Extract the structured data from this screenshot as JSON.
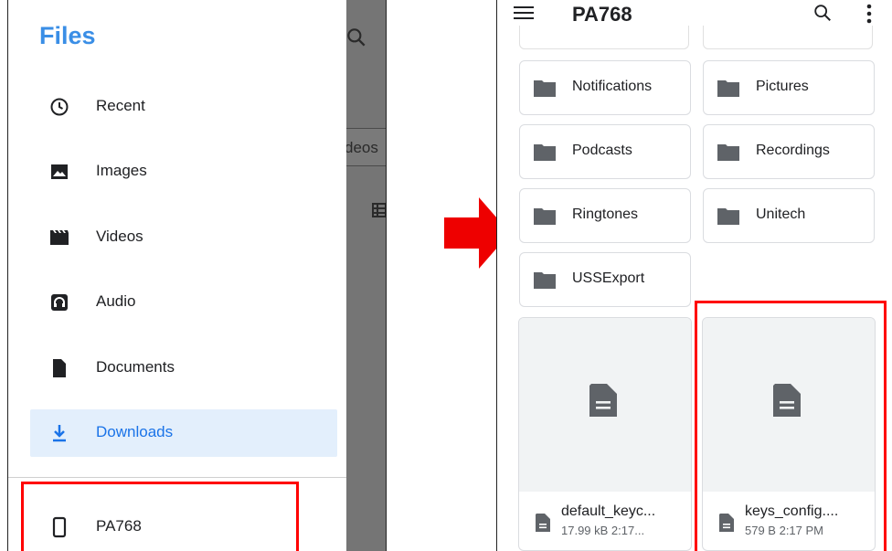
{
  "left_panel": {
    "drawer_title": "Files",
    "background": {
      "search_icon": "search-icon",
      "chip_label": "deos",
      "grid_icon": "grid-view-icon"
    },
    "nav_items": [
      {
        "label": "Recent",
        "icon": "clock-icon",
        "active": false
      },
      {
        "label": "Images",
        "icon": "image-icon",
        "active": false
      },
      {
        "label": "Videos",
        "icon": "film-icon",
        "active": false
      },
      {
        "label": "Audio",
        "icon": "headphones-icon",
        "active": false
      },
      {
        "label": "Documents",
        "icon": "document-icon",
        "active": false
      },
      {
        "label": "Downloads",
        "icon": "download-icon",
        "active": true
      }
    ],
    "device_item": {
      "label": "PA768",
      "icon": "phone-icon"
    }
  },
  "right_panel": {
    "title": "PA768",
    "menu_icon": "menu-icon",
    "search_icon": "search-icon",
    "more_icon": "more-vert-icon",
    "folders": [
      {
        "name": "Notifications"
      },
      {
        "name": "Pictures"
      },
      {
        "name": "Podcasts"
      },
      {
        "name": "Recordings"
      },
      {
        "name": "Ringtones"
      },
      {
        "name": "Unitech"
      },
      {
        "name": "USSExport"
      }
    ],
    "files": [
      {
        "name": "default_keyc...",
        "meta": "17.99 kB 2:17..."
      },
      {
        "name": "keys_config....",
        "meta": "579 B 2:17 PM"
      }
    ]
  },
  "colors": {
    "accent": "#3a8ee6",
    "active_bg": "#e3effc",
    "highlight": "#ff0000",
    "arrow": "#ee0000",
    "scrim": "#757575"
  }
}
